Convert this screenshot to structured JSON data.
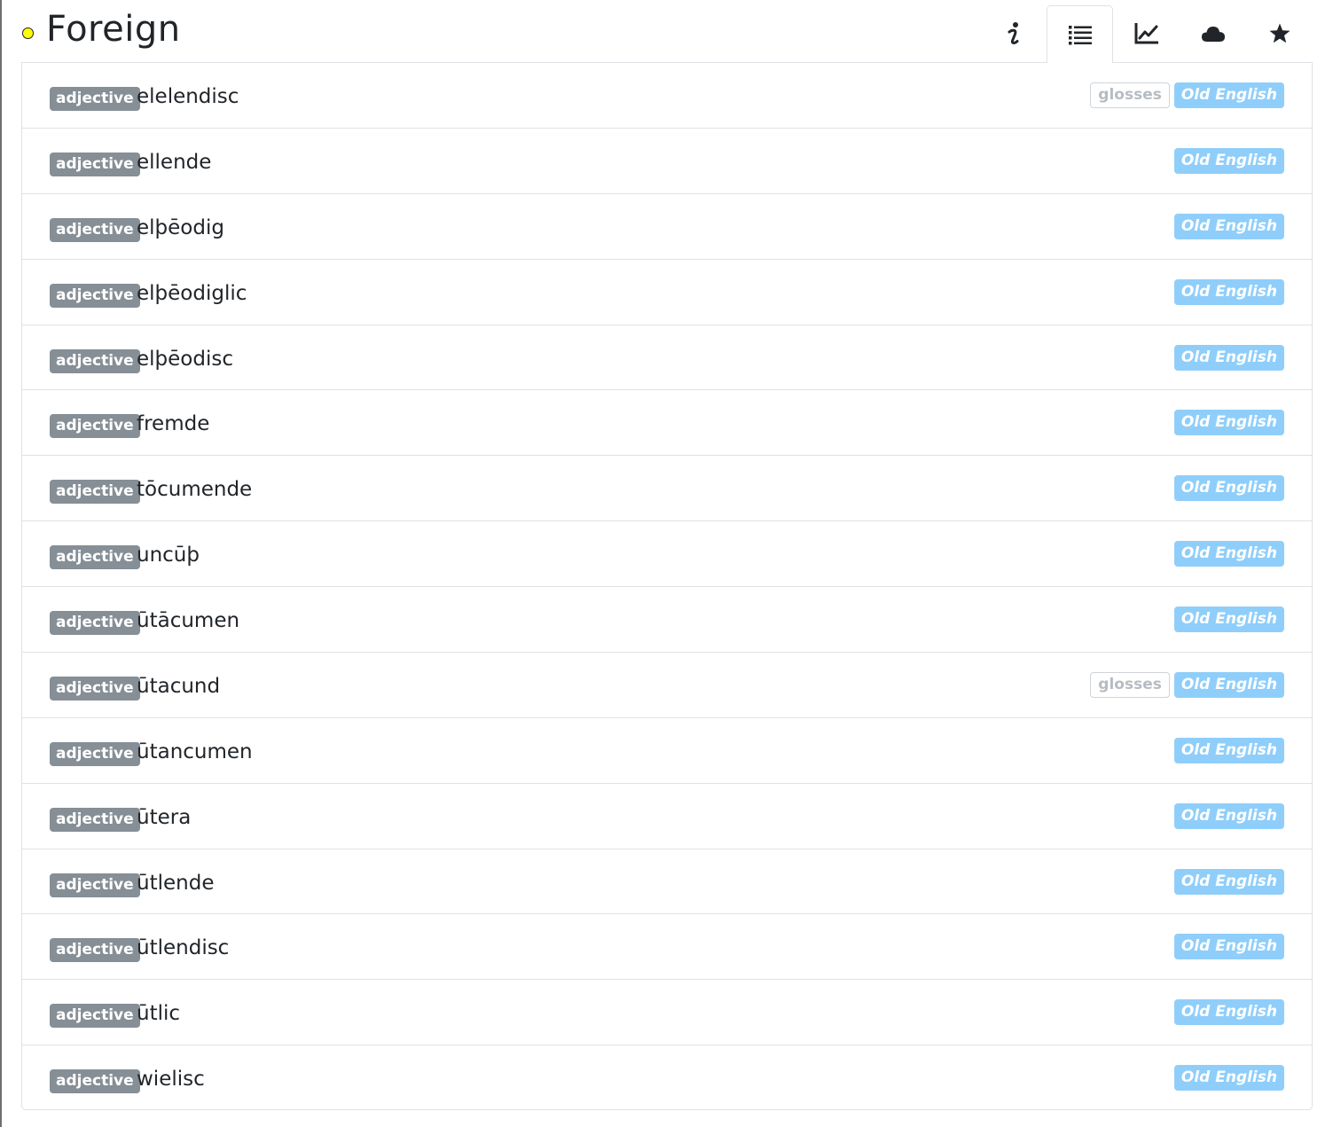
{
  "header": {
    "title": "Foreign",
    "status_color": "#ffff00",
    "tabs": [
      {
        "name": "info",
        "icon": "info-icon",
        "active": false
      },
      {
        "name": "list",
        "icon": "list-icon",
        "active": true
      },
      {
        "name": "chart",
        "icon": "line-chart-icon",
        "active": false
      },
      {
        "name": "cloud",
        "icon": "cloud-icon",
        "active": false
      },
      {
        "name": "favorite",
        "icon": "star-icon",
        "active": false
      }
    ]
  },
  "colors": {
    "pos_badge": "#868e96",
    "lang_badge": "#8fcefa",
    "gloss_border": "#cfd4d8"
  },
  "entries": [
    {
      "pos": "adjective",
      "word": "elelendisc",
      "glosses": "glosses",
      "lang": "Old English"
    },
    {
      "pos": "adjective",
      "word": "ellende",
      "lang": "Old English"
    },
    {
      "pos": "adjective",
      "word": "elþēodig",
      "lang": "Old English"
    },
    {
      "pos": "adjective",
      "word": "elþēodiglic",
      "lang": "Old English"
    },
    {
      "pos": "adjective",
      "word": "elþēodisc",
      "lang": "Old English"
    },
    {
      "pos": "adjective",
      "word": "fremde",
      "lang": "Old English"
    },
    {
      "pos": "adjective",
      "word": "tōcumende",
      "lang": "Old English"
    },
    {
      "pos": "adjective",
      "word": "uncūþ",
      "lang": "Old English"
    },
    {
      "pos": "adjective",
      "word": "ūtācumen",
      "lang": "Old English"
    },
    {
      "pos": "adjective",
      "word": "ūtacund",
      "glosses": "glosses",
      "lang": "Old English"
    },
    {
      "pos": "adjective",
      "word": "ūtancumen",
      "lang": "Old English"
    },
    {
      "pos": "adjective",
      "word": "ūtera",
      "lang": "Old English"
    },
    {
      "pos": "adjective",
      "word": "ūtlende",
      "lang": "Old English"
    },
    {
      "pos": "adjective",
      "word": "ūtlendisc",
      "lang": "Old English"
    },
    {
      "pos": "adjective",
      "word": "ūtlic",
      "lang": "Old English"
    },
    {
      "pos": "adjective",
      "word": "wielisc",
      "lang": "Old English"
    }
  ]
}
